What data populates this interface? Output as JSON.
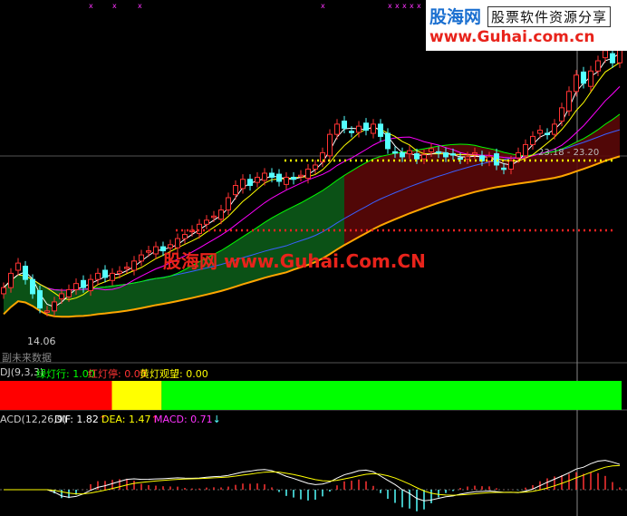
{
  "watermark": {
    "logo": "股海网",
    "tagline": "股票软件资源分享",
    "url": "www.Guhai.com.cn",
    "center_text": "股海网 www.Guhai.Com.CN"
  },
  "main_panel": {
    "low_price_label": "14.06",
    "upper_price_label": "23.18 - 23.20",
    "bottom_text": "副未来数据"
  },
  "kdj_panel": {
    "name": "DJ(9,3,3)",
    "green_label": "绿灯行: 1.00",
    "red_label": "红灯停: 0.00",
    "yellow_label": "黄灯观望: 0.00"
  },
  "macd_panel": {
    "name": "ACD(12,26,9)",
    "dif_label": "DIF: 1.82",
    "dea_label": "DEA: 1.47",
    "macd_label": "MACD: 0.71",
    "dif_arrow": "↑",
    "dea_arrow": "↑",
    "macd_arrow": "↓"
  },
  "colors": {
    "background": "#000000",
    "up_candle": "#ff3333",
    "down_candle": "#54ffff",
    "ma5": "#ffffff",
    "ma10": "#ffff00",
    "ma20": "#ff00ff",
    "ma30": "#00ff00",
    "ma60": "#3a5fff",
    "ribbon_fast": "#ffa500",
    "band_green": "#0c5a18",
    "band_red": "#5a0808",
    "signal_green": "#00ff00",
    "signal_red": "#ff0000",
    "signal_yellow": "#ffff00",
    "dif": "#ffffff",
    "dea": "#ffff00",
    "macd_pos": "#ff3333",
    "macd_neg": "#54ffff"
  },
  "chart_data": [
    {
      "type": "candlestick",
      "title": "",
      "price_range": [
        12.5,
        27.5
      ],
      "close_series": [
        15.2,
        15.9,
        16.4,
        15.6,
        14.9,
        14.2,
        14.06,
        14.5,
        14.9,
        15.1,
        15.4,
        15.2,
        15.6,
        15.9,
        15.7,
        15.9,
        16.0,
        16.2,
        16.5,
        16.8,
        17.0,
        17.2,
        17.0,
        17.3,
        17.6,
        17.8,
        18.0,
        18.3,
        18.5,
        18.7,
        19.0,
        19.6,
        20.2,
        20.5,
        20.2,
        20.6,
        20.8,
        20.6,
        20.4,
        20.6,
        20.5,
        20.7,
        21.0,
        21.2,
        21.8,
        22.7,
        23.2,
        23.0,
        22.8,
        23.1,
        22.9,
        23.2,
        22.6,
        22.0,
        21.8,
        21.6,
        21.9,
        21.5,
        21.7,
        22.0,
        21.8,
        21.6,
        21.7,
        21.5,
        21.6,
        21.8,
        21.4,
        21.6,
        21.2,
        21.0,
        21.4,
        21.8,
        22.2,
        22.6,
        22.9,
        22.7,
        23.2,
        24.0,
        24.8,
        25.6,
        25.2,
        25.8,
        26.3,
        26.8,
        26.2,
        27.0
      ]
    },
    {
      "type": "bar",
      "title": "",
      "signal_segments": [
        {
          "color": "red",
          "share": 0.18
        },
        {
          "color": "yellow",
          "share": 0.08
        },
        {
          "color": "green",
          "share": 0.74
        }
      ]
    },
    {
      "type": "line",
      "title": "",
      "series": [
        {
          "name": "DIF",
          "value": 1.82
        },
        {
          "name": "DEA",
          "value": 1.47
        },
        {
          "name": "MACD",
          "value": 0.71
        }
      ]
    }
  ]
}
